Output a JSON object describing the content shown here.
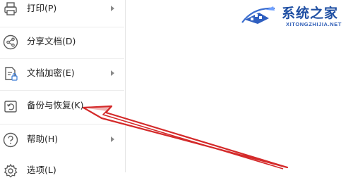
{
  "menu": {
    "items": [
      {
        "label": "打印(P)",
        "icon": "printer-icon",
        "has_submenu": true
      },
      {
        "label": "分享文档(D)",
        "icon": "share-icon",
        "has_submenu": false
      },
      {
        "label": "文档加密(E)",
        "icon": "document-lock-icon",
        "has_submenu": true
      },
      {
        "label": "备份与恢复(K)",
        "icon": "backup-restore-icon",
        "has_submenu": false
      },
      {
        "label": "帮助(H)",
        "icon": "help-icon",
        "has_submenu": true
      },
      {
        "label": "选项(L)",
        "icon": "gear-icon",
        "has_submenu": false
      }
    ]
  },
  "watermark": {
    "brand": "系统之家",
    "domain": "XITONGZHIJIA.NET"
  },
  "colors": {
    "annotation_arrow": "#d42a2a",
    "brand_blue": "#1f4fa3",
    "icon_gray": "#5a5a5a"
  }
}
